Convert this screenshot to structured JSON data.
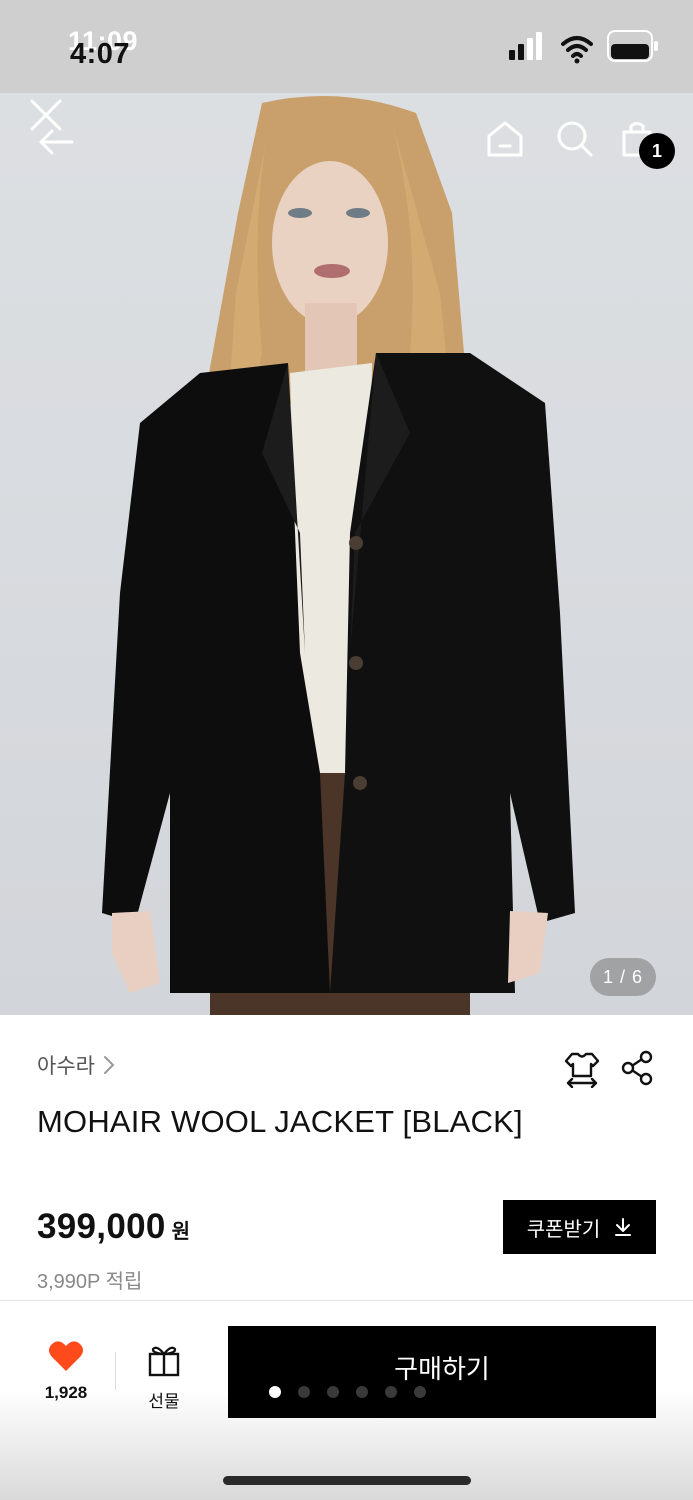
{
  "status_bar": {
    "time_overlay": "11:09",
    "time": "4:07",
    "icons": [
      "signal-icon",
      "wifi-icon",
      "battery-icon"
    ]
  },
  "top_nav": {
    "icons": [
      "close-icon",
      "back-arrow-icon",
      "home-icon",
      "search-icon",
      "cart-icon"
    ],
    "cart_count": "1"
  },
  "gallery": {
    "counter": "1 / 6",
    "total_images": 6,
    "current_image": 1
  },
  "product": {
    "brand": "아수라",
    "title": "MOHAIR WOOL JACKET [BLACK]",
    "price": "399,000",
    "currency": "원",
    "points": "3,990P 적립",
    "coupon_label": "쿠폰받기"
  },
  "bottom_bar": {
    "like_count": "1,928",
    "gift_label": "선물",
    "buy_label": "구매하기"
  },
  "colors": {
    "accent_heart": "#ff4a1c",
    "button_bg": "#000000",
    "background": "#ffffff"
  }
}
